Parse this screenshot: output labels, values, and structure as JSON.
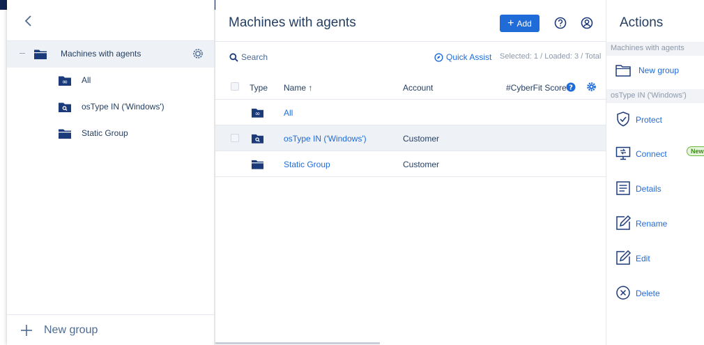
{
  "left_panel": {
    "tree": [
      {
        "label": "Machines with agents"
      },
      {
        "label": "All"
      },
      {
        "label": "osType IN ('Windows')"
      },
      {
        "label": "Static Group"
      }
    ],
    "footer_label": "New group"
  },
  "main": {
    "title": "Machines with agents",
    "add_label": "Add",
    "search_placeholder": "Search",
    "quick_assist_label": "Quick Assist",
    "selection_status": "Selected: 1 / Loaded: 3 / Total",
    "columns": {
      "type": "Type",
      "name": "Name ↑",
      "account": "Account",
      "cyberfit": "#CyberFit Score"
    },
    "rows": [
      {
        "name": "All",
        "account": "",
        "icon": "infinity-folder-icon"
      },
      {
        "name": "osType IN ('Windows')",
        "account": "Customer",
        "icon": "search-folder-icon"
      },
      {
        "name": "Static Group",
        "account": "Customer",
        "icon": "folder-icon"
      }
    ]
  },
  "actions": {
    "title": "Actions",
    "section_1": "Machines with agents",
    "new_group": "New group",
    "section_2": "osType IN ('Windows')",
    "protect": "Protect",
    "connect": "Connect",
    "connect_badge": "New",
    "details": "Details",
    "rename": "Rename",
    "edit": "Edit",
    "delete": "Delete"
  },
  "colors": {
    "accent": "#1f6bd8",
    "folder": "#1b3a7a",
    "text": "#243e61",
    "badge_green": "#67b83a"
  }
}
